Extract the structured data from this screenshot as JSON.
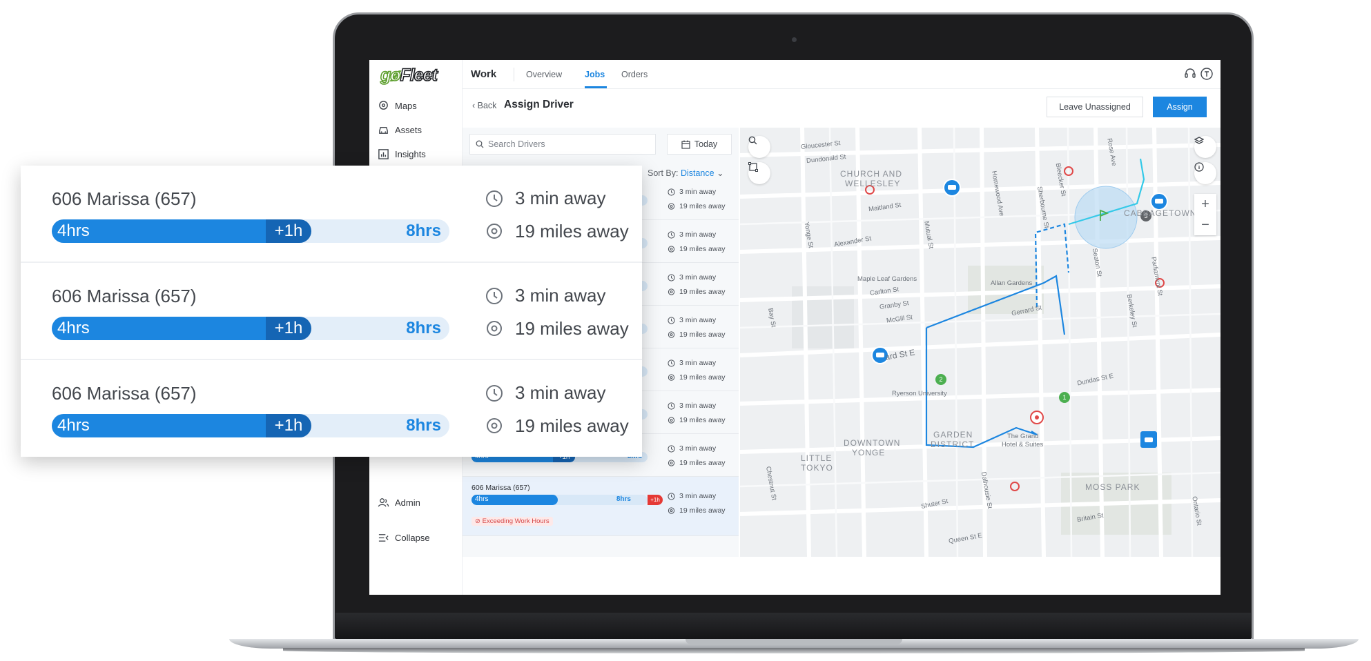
{
  "app": {
    "logo_go": "gø",
    "logo_fleet": "Fleet",
    "section": "Work",
    "tabs": [
      "Overview",
      "Jobs",
      "Orders"
    ],
    "active_tab": "Jobs"
  },
  "sidebar": {
    "items": [
      {
        "label": "Maps",
        "icon": "map-pin-icon"
      },
      {
        "label": "Assets",
        "icon": "car-icon"
      },
      {
        "label": "Insights",
        "icon": "bar-chart-icon"
      }
    ],
    "bottom": [
      {
        "label": "Admin",
        "icon": "users-icon"
      },
      {
        "label": "Collapse",
        "icon": "collapse-icon"
      }
    ]
  },
  "header": {
    "back_label": "Back",
    "title": "Assign Driver",
    "leave_unassigned": "Leave Unassigned",
    "assign": "Assign"
  },
  "list": {
    "search_placeholder": "Search Drivers",
    "date_filter": "Today",
    "sort_label": "Sort By:",
    "sort_value": "Distance",
    "rows": [
      {
        "name": "606 Marissa (657)",
        "hours": "4hrs",
        "overtime": "+1h",
        "limit": "8hrs",
        "eta": "3 min away",
        "distance": "19 miles away"
      },
      {
        "name": "606 Marissa (657)",
        "hours": "4hrs",
        "overtime": "+1h",
        "limit": "8hrs",
        "eta": "3 min away",
        "distance": "19 miles away"
      },
      {
        "name": "606 Marissa (657)",
        "hours": "4hrs",
        "overtime": "+1h",
        "limit": "8hrs",
        "eta": "3 min away",
        "distance": "19 miles away"
      },
      {
        "name": "606 Marissa (657)",
        "hours": "4hrs",
        "overtime": "+1h",
        "limit": "8hrs",
        "eta": "3 min away",
        "distance": "19 miles away"
      },
      {
        "name": "606 Marissa (657)",
        "hours": "4hrs",
        "overtime": "+1h",
        "limit": "8hrs",
        "eta": "3 min away",
        "distance": "19 miles away"
      },
      {
        "name": "606 Marissa (657)",
        "hours": "4hrs",
        "overtime": "+1h",
        "limit": "8hrs",
        "eta": "3 min away",
        "distance": "19 miles away"
      },
      {
        "name": "606 Marissa (657)",
        "hours": "4hrs",
        "overtime": "+1h",
        "limit": "8hrs",
        "eta": "3 min away",
        "distance": "19 miles away"
      }
    ],
    "selected": {
      "name": "606 Marissa (657)",
      "hours": "4hrs",
      "limit": "8hrs",
      "overtime": "+1h",
      "eta": "3 min away",
      "distance": "19 miles away",
      "warning": "Exceeding Work Hours"
    }
  },
  "map": {
    "labels": {
      "gloucester": "Gloucester St",
      "dundonald": "Dundonald St",
      "church": "CHURCH AND",
      "wellesley": "WELLESLEY",
      "maitland": "Maitland St",
      "alexander": "Alexander St",
      "yonge": "Yonge St",
      "mutual": "Mutual St",
      "homewood": "Homewood Ave",
      "sherbourne": "Sherbourne St",
      "bleecker": "Bleecker St",
      "rose": "Rose Ave",
      "cabbagetown": "CABBAGETOWN",
      "maple": "Maple Leaf Gardens",
      "carlton": "Carlton St",
      "granby": "Granby St",
      "mcgill": "McGill St",
      "allan": "Allan Gardens",
      "gerrard": "Gerrard St",
      "gerrard_w": "ard St E",
      "bay": "Bay St",
      "ryerson": "Ryerson University",
      "dundas": "Dundas St E",
      "downtown": "DOWNTOWN",
      "yonge_d": "YONGE",
      "garden": "GARDEN",
      "district": "DISTRICT",
      "grand": "The Grand",
      "grand2": "Hotel & Suites",
      "little": "LITTLE",
      "tokyo": "TOKYO",
      "chestnut": "Chestnut St",
      "shuter": "Shuter St",
      "dalhousie": "Dalhousie St",
      "moss": "MOSS PARK",
      "britain": "Britain St",
      "queen": "Queen St E",
      "ontario": "Ontario St",
      "parliament": "Parliament St",
      "berkeley": "Berkeley St",
      "seaton": "Seaton St"
    },
    "pins": [
      "1",
      "2",
      "3"
    ]
  },
  "callout": {
    "rows": [
      {
        "name": "606 Marissa (657)",
        "hours": "4hrs",
        "overtime": "+1h",
        "limit": "8hrs",
        "eta": "3 min away",
        "distance": "19 miles away"
      },
      {
        "name": "606 Marissa (657)",
        "hours": "4hrs",
        "overtime": "+1h",
        "limit": "8hrs",
        "eta": "3 min away",
        "distance": "19 miles away"
      },
      {
        "name": "606 Marissa (657)",
        "hours": "4hrs",
        "overtime": "+1h",
        "limit": "8hrs",
        "eta": "3 min away",
        "distance": "19 miles away"
      }
    ]
  },
  "colors": {
    "accent": "#1c86e0",
    "overtime": "#1565b4",
    "route": "#1c86e0",
    "warning": "#e53935",
    "pin_green": "#4caf50"
  }
}
